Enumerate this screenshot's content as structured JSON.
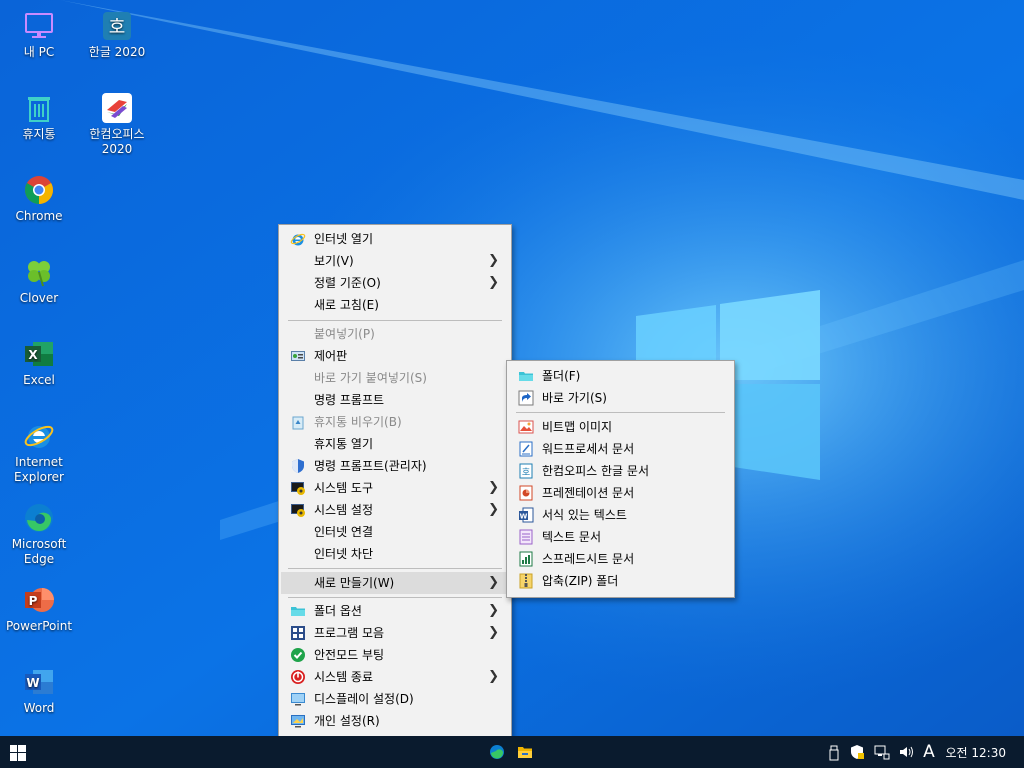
{
  "desktop": {
    "icons": [
      {
        "id": "my-pc",
        "label": "내 PC",
        "icon": "monitor-icon"
      },
      {
        "id": "hangul",
        "label": "한글 2020",
        "icon": "hangul-icon"
      },
      {
        "id": "recycle",
        "label": "휴지통",
        "icon": "recycle-bin-icon"
      },
      {
        "id": "hancom",
        "label": "한컴오피스\n2020",
        "label_l1": "한컴오피스",
        "label_l2": "2020",
        "icon": "hancom-office-icon"
      },
      {
        "id": "chrome",
        "label": "Chrome",
        "icon": "chrome-icon"
      },
      {
        "id": "clover",
        "label": "Clover",
        "icon": "clover-icon"
      },
      {
        "id": "excel",
        "label": "Excel",
        "icon": "excel-icon"
      },
      {
        "id": "ie",
        "label_l1": "Internet",
        "label_l2": "Explorer",
        "icon": "ie-icon"
      },
      {
        "id": "edge",
        "label_l1": "Microsoft",
        "label_l2": "Edge",
        "icon": "edge-icon"
      },
      {
        "id": "powerpoint",
        "label": "PowerPoint",
        "icon": "powerpoint-icon"
      },
      {
        "id": "word",
        "label": "Word",
        "icon": "word-icon"
      }
    ]
  },
  "context_menu": {
    "items": [
      {
        "label": "인터넷 열기",
        "icon": "ie-icon"
      },
      {
        "label": "보기(V)",
        "submenu": true
      },
      {
        "label": "정렬 기준(O)",
        "submenu": true
      },
      {
        "label": "새로 고침(E)"
      },
      {
        "label": "붙여넣기(P)",
        "disabled": true
      },
      {
        "label": "제어판",
        "icon": "control-panel-icon"
      },
      {
        "label": "바로 가기 붙여넣기(S)",
        "disabled": true
      },
      {
        "label": "명령 프롬프트"
      },
      {
        "label": "휴지통 비우기(B)",
        "disabled": true,
        "icon": "recycle-bin-icon"
      },
      {
        "label": "휴지통 열기"
      },
      {
        "label": "명령 프롬프트(관리자)",
        "icon": "shield-icon"
      },
      {
        "label": "시스템 도구",
        "icon": "system-tools-icon",
        "submenu": true
      },
      {
        "label": "시스템 설정",
        "icon": "system-settings-icon",
        "submenu": true
      },
      {
        "label": "인터넷 연결"
      },
      {
        "label": "인터넷 차단"
      },
      {
        "label": "새로 만들기(W)",
        "submenu": true,
        "highlighted": true
      },
      {
        "label": "폴더 옵션",
        "icon": "folder-icon",
        "submenu": true
      },
      {
        "label": "프로그램 모음",
        "icon": "programs-icon",
        "submenu": true
      },
      {
        "label": "안전모드 부팅",
        "icon": "check-circle-icon"
      },
      {
        "label": "시스템 종료",
        "icon": "power-icon",
        "submenu": true
      },
      {
        "label": "디스플레이 설정(D)",
        "icon": "display-icon"
      },
      {
        "label": "개인 설정(R)",
        "icon": "personalize-icon"
      }
    ]
  },
  "new_submenu": {
    "items": [
      {
        "label": "폴더(F)",
        "icon": "folder-icon"
      },
      {
        "label": "바로 가기(S)",
        "icon": "shortcut-icon"
      },
      {
        "label": "비트맵 이미지",
        "icon": "bitmap-icon"
      },
      {
        "label": "워드프로세서 문서",
        "icon": "wordpad-icon"
      },
      {
        "label": "한컴오피스 한글 문서",
        "icon": "hangul-doc-icon"
      },
      {
        "label": "프레젠테이션 문서",
        "icon": "presentation-icon"
      },
      {
        "label": "서식 있는 텍스트",
        "icon": "rtf-icon"
      },
      {
        "label": "텍스트 문서",
        "icon": "text-doc-icon"
      },
      {
        "label": "스프레드시트 문서",
        "icon": "spreadsheet-icon"
      },
      {
        "label": "압축(ZIP) 폴더",
        "icon": "zip-folder-icon"
      }
    ]
  },
  "taskbar": {
    "start_icon": "windows-logo-icon",
    "pinned": [
      "edge-icon",
      "file-explorer-icon"
    ],
    "tray": [
      "usb-icon",
      "security-icon",
      "network-icon",
      "volume-icon"
    ],
    "ime": "A",
    "clock": "오전 12:30"
  },
  "colors": {
    "accent": "#0a5fd0",
    "menu_bg": "#f2f2f2",
    "taskbar": "#0a1b2e"
  }
}
